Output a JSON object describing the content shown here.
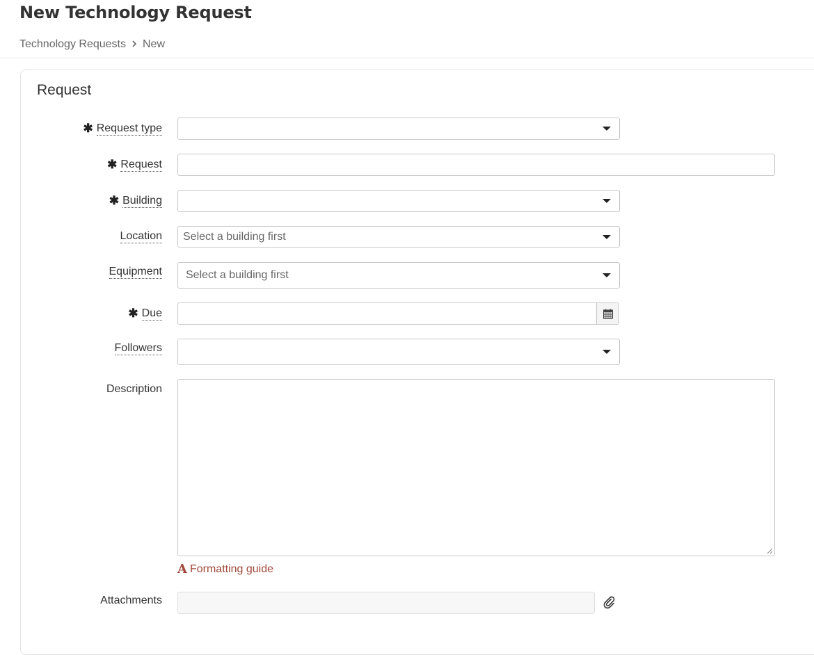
{
  "page": {
    "title": "New Technology Request"
  },
  "breadcrumb": {
    "items": [
      "Technology Requests",
      "New"
    ]
  },
  "panel": {
    "title": "Request"
  },
  "form": {
    "request_type": {
      "label": "Request type",
      "required": "✱",
      "value": ""
    },
    "request": {
      "label": "Request",
      "required": "✱",
      "value": ""
    },
    "building": {
      "label": "Building",
      "required": "✱",
      "value": ""
    },
    "location": {
      "label": "Location",
      "placeholder": "Select a building first"
    },
    "equipment": {
      "label": "Equipment",
      "placeholder": "Select a building first"
    },
    "due": {
      "label": "Due",
      "required": "✱",
      "value": ""
    },
    "followers": {
      "label": "Followers",
      "value": ""
    },
    "description": {
      "label": "Description",
      "value": ""
    },
    "formatting_guide": {
      "icon": "A",
      "label": "Formatting guide"
    },
    "attachments": {
      "label": "Attachments"
    }
  },
  "colors": {
    "accent_link": "#a0483a",
    "border": "#c9c9c9"
  },
  "icons": {
    "calendar": "calendar-icon",
    "paperclip": "paperclip-icon",
    "caret": "caret-down-icon",
    "breadcrumb_separator": "chevron-right-icon",
    "required": "asterisk-icon"
  }
}
